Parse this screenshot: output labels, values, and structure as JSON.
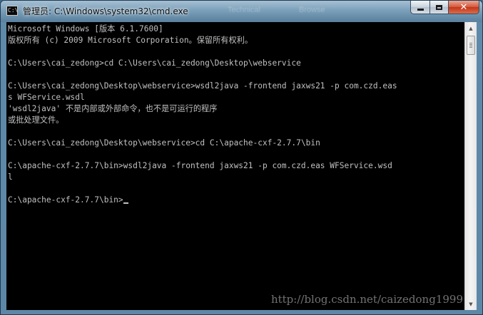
{
  "window": {
    "title": "管理员: C:\\Windows\\system32\\cmd.exe",
    "icon": "console-app-icon",
    "icon_text": "C:\\",
    "background_blur_text": [
      "Technical",
      "Browse"
    ],
    "buttons": {
      "minimize": "minimize-icon",
      "maximize": "maximize-icon",
      "close": "✕"
    }
  },
  "console": {
    "lines": [
      "Microsoft Windows [版本 6.1.7600]",
      "版权所有 (c) 2009 Microsoft Corporation。保留所有权利。",
      "",
      "C:\\Users\\cai_zedong>cd C:\\Users\\cai_zedong\\Desktop\\webservice",
      "",
      "C:\\Users\\cai_zedong\\Desktop\\webservice>wsdl2java -frontend jaxws21 -p com.czd.eas",
      "s WFService.wsdl",
      "'wsdl2java' 不是内部或外部命令，也不是可运行的程序",
      "或批处理文件。",
      "",
      "C:\\Users\\cai_zedong\\Desktop\\webservice>cd C:\\apache-cxf-2.7.7\\bin",
      "",
      "C:\\apache-cxf-2.7.7\\bin>wsdl2java -frontend jaxws21 -p com.czd.eas WFService.wsd",
      "l",
      "",
      "C:\\apache-cxf-2.7.7\\bin>"
    ],
    "foreground": "#c0c0c0",
    "background": "#000000",
    "watermark": "http://blog.csdn.net/caizedong1999"
  },
  "scrollbar": {
    "up_arrow": "▲",
    "down_arrow": "▼"
  }
}
